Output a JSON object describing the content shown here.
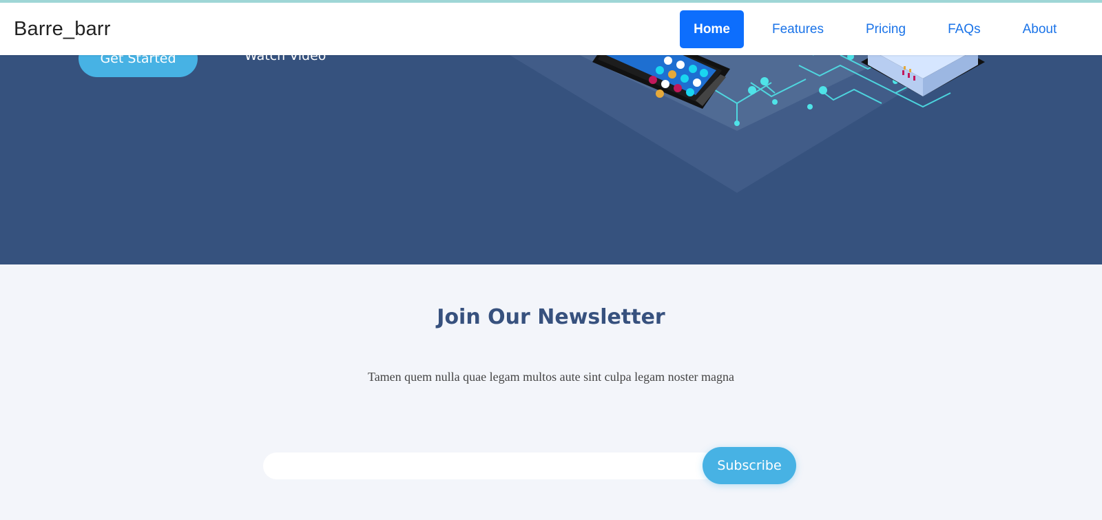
{
  "brand": "Barre_barr",
  "nav": {
    "items": [
      {
        "label": "Home",
        "active": true
      },
      {
        "label": "Features",
        "active": false
      },
      {
        "label": "Pricing",
        "active": false
      },
      {
        "label": "FAQs",
        "active": false
      },
      {
        "label": "About",
        "active": false
      }
    ]
  },
  "hero": {
    "get_started_label": "Get Started",
    "watch_video_label": "Watch Video",
    "illustration_icon": "isometric-tech-illustration-icon"
  },
  "newsletter": {
    "title": "Join Our Newsletter",
    "description": "Tamen quem nulla quae legam multos aute sint culpa legam noster magna",
    "input_value": "",
    "subscribe_label": "Subscribe"
  },
  "colors": {
    "hero_bg": "#36527e",
    "accent": "#47b2e4",
    "nav_active": "#0d6efd",
    "nav_link": "#1a73e8",
    "section_bg": "#f3f5fa",
    "title_color": "#37517e"
  }
}
